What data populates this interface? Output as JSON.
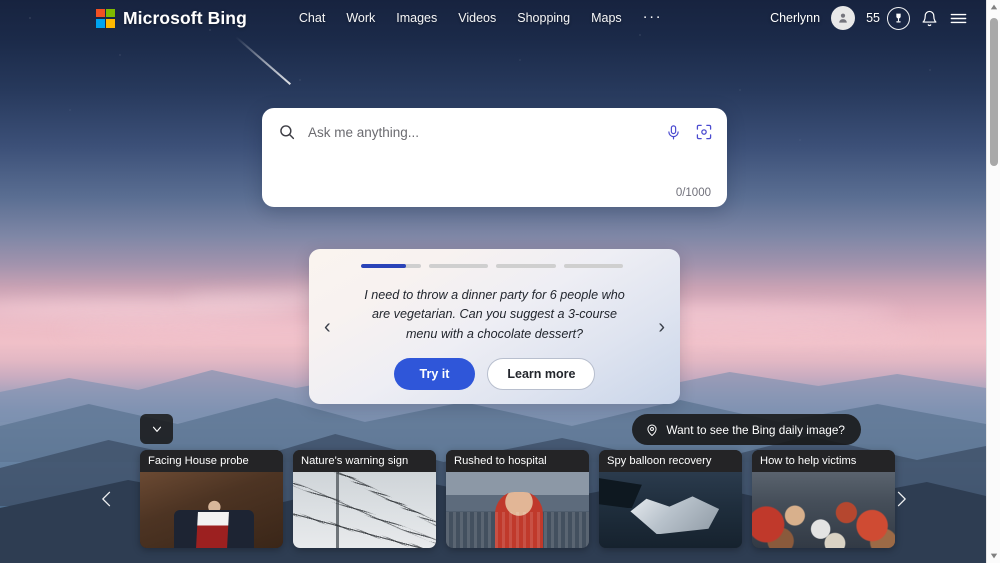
{
  "header": {
    "brand_name": "Microsoft Bing",
    "logo_colors": [
      "#f25022",
      "#7fba00",
      "#00a4ef",
      "#ffb900"
    ],
    "nav_items": [
      {
        "label": "Chat"
      },
      {
        "label": "Work"
      },
      {
        "label": "Images"
      },
      {
        "label": "Videos"
      },
      {
        "label": "Shopping"
      },
      {
        "label": "Maps"
      }
    ],
    "more_label": "···",
    "user_name": "Cherlynn",
    "reward_points": "55",
    "avatar_icon": "person-icon",
    "rewards_icon": "rewards-trophy-icon",
    "notifications_icon": "bell-icon",
    "menu_icon": "hamburger-menu-icon"
  },
  "search": {
    "placeholder": "Ask me anything...",
    "value": "",
    "counter": "0/1000",
    "search_icon": "search-icon",
    "mic_icon": "microphone-icon",
    "visual_icon": "visual-search-icon",
    "accent_color": "#4b4bd0"
  },
  "suggestion_card": {
    "segments": [
      {
        "fill_percent": 76,
        "active": true
      },
      {
        "fill_percent": 0,
        "active": false
      },
      {
        "fill_percent": 0,
        "active": false
      },
      {
        "fill_percent": 0,
        "active": false
      }
    ],
    "prompt": "I need to throw a dinner party for 6 people who are vegetarian. Can you suggest a 3-course menu with a chocolate dessert?",
    "primary_button": "Try it",
    "secondary_button": "Learn more",
    "prev_arrow": "‹",
    "next_arrow": "›",
    "accent_color": "#2a43b8"
  },
  "daily_image_pill": {
    "label": "Want to see the Bing daily image?",
    "icon": "location-pin-icon"
  },
  "collapse_button": {
    "icon": "chevron-down-icon"
  },
  "news_carousel": {
    "cards": [
      {
        "title": "Facing House probe",
        "image": "ph-congress"
      },
      {
        "title": "Nature's warning sign",
        "image": "ph-wires"
      },
      {
        "title": "Rushed to hospital",
        "image": "ph-stadium"
      },
      {
        "title": "Spy balloon recovery",
        "image": "ph-balloon"
      },
      {
        "title": "How to help victims",
        "image": "ph-crowd"
      }
    ],
    "prev_arrow": "chevron-left-icon",
    "next_arrow": "chevron-right-icon"
  },
  "scrollbar": {
    "up_arrow": "scroll-up-arrow",
    "down_arrow": "scroll-down-arrow"
  }
}
